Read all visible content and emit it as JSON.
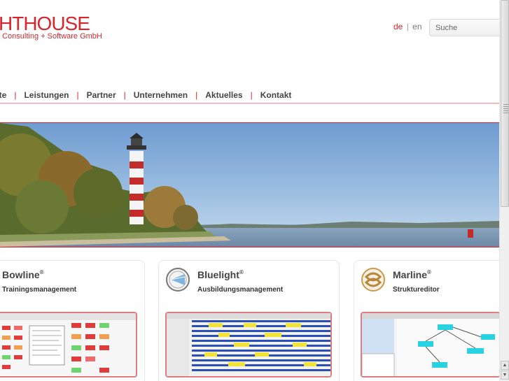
{
  "header": {
    "logo_title": "HTHOUSE",
    "logo_subtitle": "t Consulting + Software GmbH",
    "lang_active": "de",
    "lang_separator": "|",
    "lang_other": "en",
    "search_placeholder": "Suche"
  },
  "nav": {
    "items": [
      "kte",
      "Leistungen",
      "Partner",
      "Unternehmen",
      "Aktuelles",
      "Kontakt"
    ],
    "divider": "|"
  },
  "products": [
    {
      "name": "Bowline",
      "reg": "®",
      "subtitle": "Trainingsmanagement",
      "icon": "bowline-icon"
    },
    {
      "name": "Bluelight",
      "reg": "®",
      "subtitle": "Ausbildungsmanagement",
      "icon": "bluelight-compass-icon"
    },
    {
      "name": "Marline",
      "reg": "®",
      "subtitle": "Strukturedit or",
      "icon": "marline-knot-icon"
    }
  ],
  "colors": {
    "brand_red": "#d9262c",
    "nav_line": "#e7a3a5",
    "screenshot_border": "#e07b7f"
  }
}
